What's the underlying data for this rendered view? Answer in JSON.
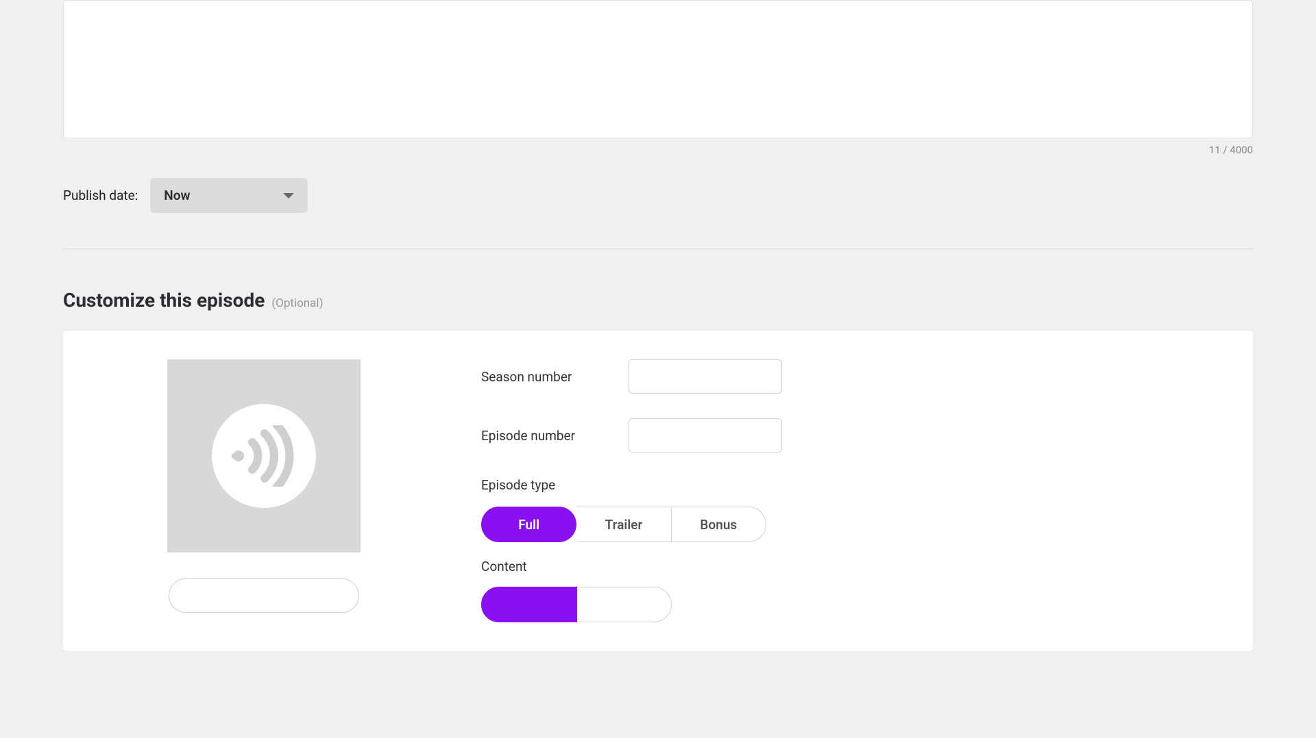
{
  "description": {
    "char_count": "11 / 4000"
  },
  "publish": {
    "label": "Publish date:",
    "value": "Now"
  },
  "customize": {
    "title": "Customize this episode",
    "optional": "(Optional)",
    "season_label": "Season number",
    "season_value": "",
    "episode_label": "Episode number",
    "episode_value": "",
    "type_label": "Episode type",
    "type_options": {
      "full": "Full",
      "trailer": "Trailer",
      "bonus": "Bonus"
    },
    "content_label": "Content"
  }
}
